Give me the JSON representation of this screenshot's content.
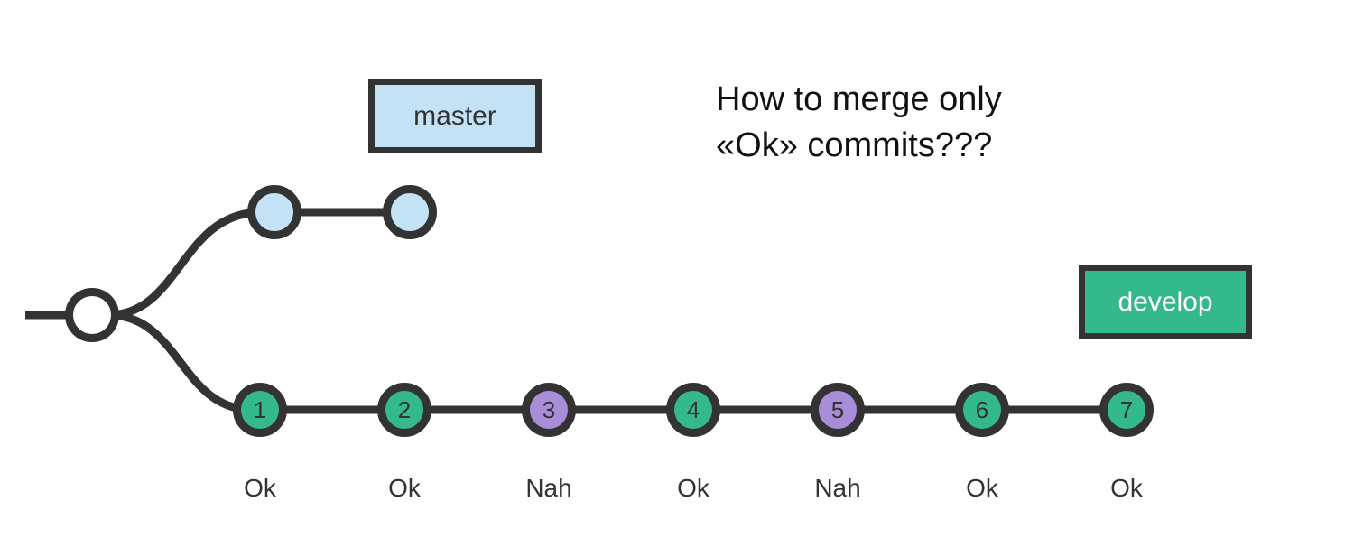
{
  "branches": {
    "master": {
      "label": "master"
    },
    "develop": {
      "label": "develop"
    }
  },
  "question": {
    "line1": "How to merge only",
    "line2": "«Ok» commits???"
  },
  "developCommits": [
    {
      "num": "1",
      "status": "Ok"
    },
    {
      "num": "2",
      "status": "Ok"
    },
    {
      "num": "3",
      "status": "Nah"
    },
    {
      "num": "4",
      "status": "Ok"
    },
    {
      "num": "5",
      "status": "Nah"
    },
    {
      "num": "6",
      "status": "Ok"
    },
    {
      "num": "7",
      "status": "Ok"
    }
  ],
  "colors": {
    "stroke": "#333333",
    "master": "#c3e2f5",
    "develop": "#34b98c",
    "bad": "#a88ed9",
    "root": "#ffffff"
  }
}
